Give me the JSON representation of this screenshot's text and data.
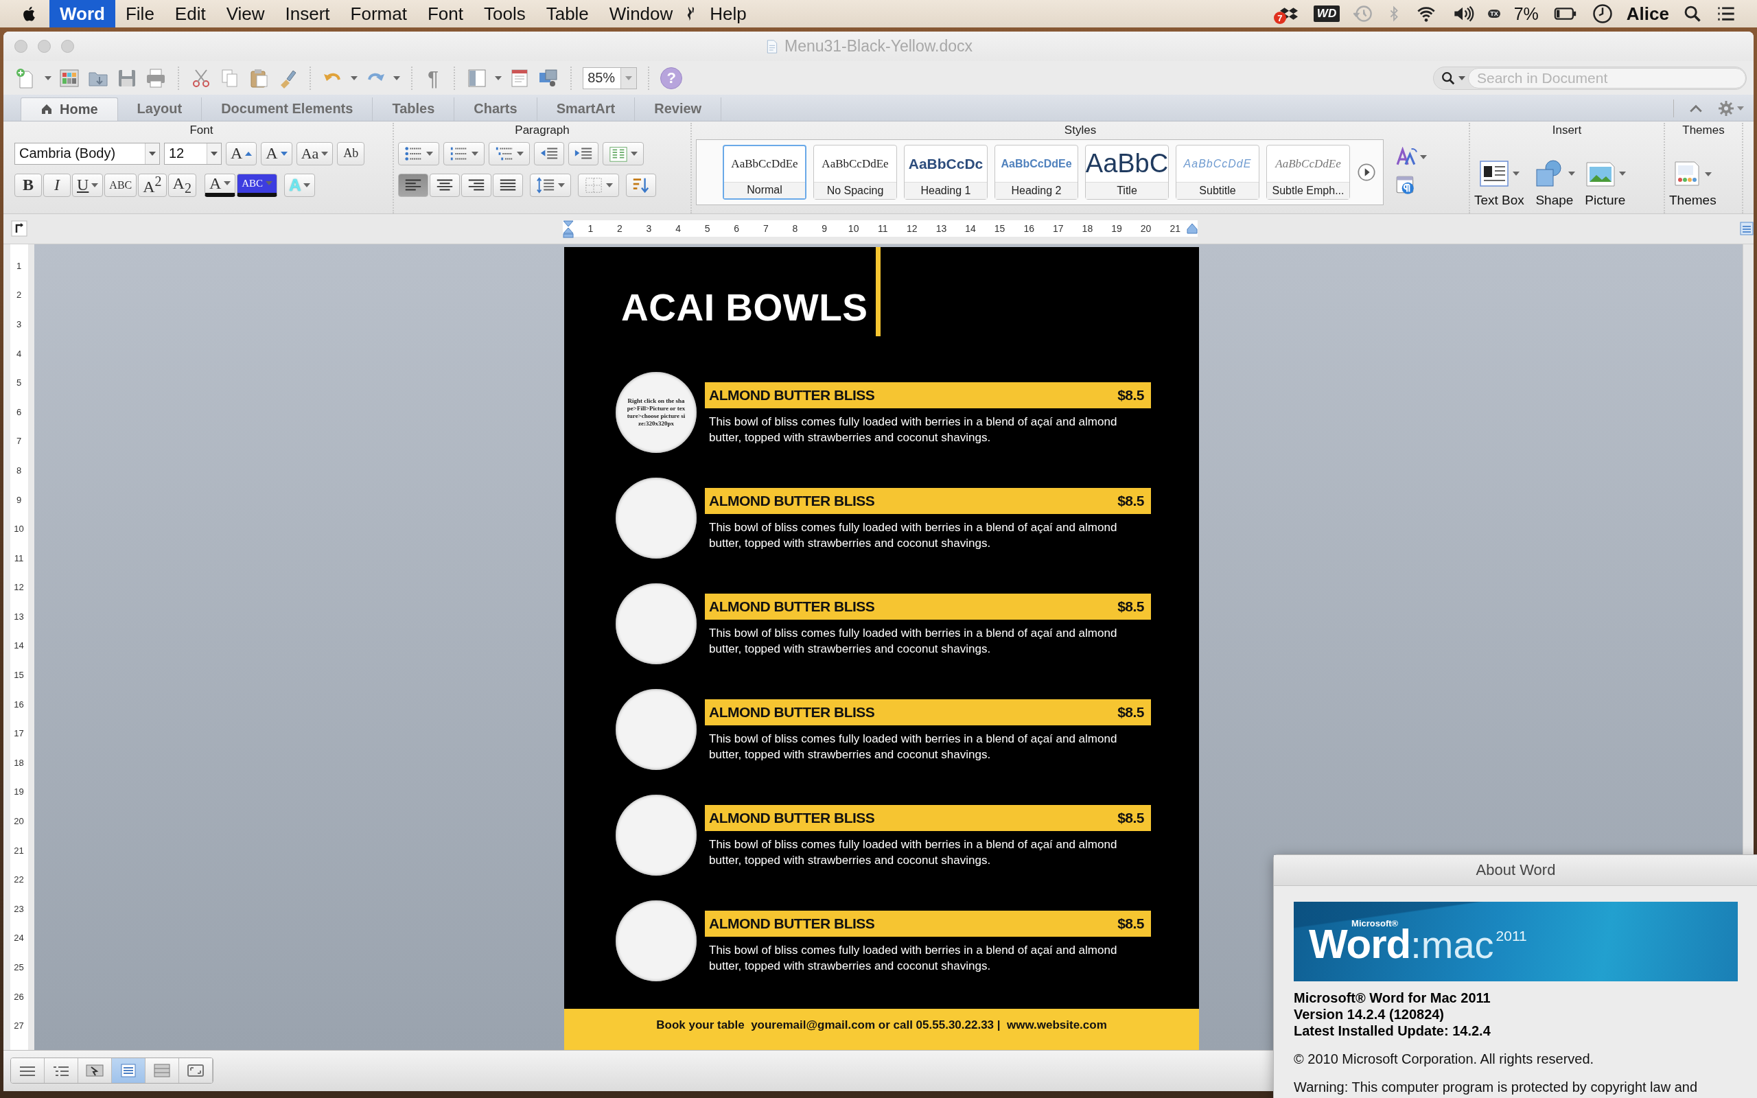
{
  "menu_bar": {
    "menus": [
      {
        "label": "Word",
        "selected": true
      },
      {
        "label": "File",
        "selected": false
      },
      {
        "label": "Edit",
        "selected": false
      },
      {
        "label": "View",
        "selected": false
      },
      {
        "label": "Insert",
        "selected": false
      },
      {
        "label": "Format",
        "selected": false
      },
      {
        "label": "Font",
        "selected": false
      },
      {
        "label": "Tools",
        "selected": false
      },
      {
        "label": "Table",
        "selected": false
      },
      {
        "label": "Window",
        "selected": false
      },
      {
        "label": "Help",
        "selected": false
      }
    ],
    "dropbox_badge": "7",
    "drive_label": "WD",
    "sync_label": "TX",
    "battery": "7%",
    "user": "Alice"
  },
  "window": {
    "title": "Menu31-Black-Yellow.docx"
  },
  "toolbar": {
    "paragraph_mark": "¶",
    "zoom": "85%",
    "help": "?",
    "search": {
      "placeholder": "Search in Document"
    }
  },
  "tabs": [
    {
      "label": "Home",
      "selected": true
    },
    {
      "label": "Layout",
      "selected": false
    },
    {
      "label": "Document Elements",
      "selected": false
    },
    {
      "label": "Tables",
      "selected": false
    },
    {
      "label": "Charts",
      "selected": false
    },
    {
      "label": "SmartArt",
      "selected": false
    },
    {
      "label": "Review",
      "selected": false
    }
  ],
  "ribbon": {
    "font": {
      "title": "Font",
      "name": "Cambria (Body)",
      "size": "12",
      "buttons": [
        {
          "label": "A",
          "kind": "grow"
        },
        {
          "label": "A",
          "kind": "shrink"
        },
        {
          "label": "Aa",
          "kind": "case"
        },
        {
          "label": "Ab",
          "kind": "clear"
        }
      ],
      "format_buttons": [
        {
          "label": "B",
          "kind": "bold"
        },
        {
          "label": "I",
          "kind": "italic"
        },
        {
          "label": "U",
          "kind": "underline"
        },
        {
          "label": "ABC",
          "kind": "strike"
        },
        {
          "label": "A$^{2}$",
          "kind": "plain"
        },
        {
          "label": "A$_{2}$",
          "kind": "plain"
        },
        {
          "label": "A",
          "kind": "color"
        },
        {
          "label": "ABC",
          "kind": "highlight"
        },
        {
          "label": "A",
          "kind": "effects"
        }
      ]
    },
    "paragraph": {
      "title": "Paragraph",
      "alignment_buttons": [
        {
          "selected": true
        },
        {
          "selected": false
        },
        {
          "selected": false
        },
        {
          "selected": false
        }
      ]
    },
    "styles": {
      "title": "Styles",
      "items": [
        {
          "preview": "AaBbCcDdEe",
          "label": "Normal",
          "kind": "normal",
          "selected": true
        },
        {
          "preview": "AaBbCcDdEe",
          "label": "No Spacing",
          "kind": "normal",
          "selected": false
        },
        {
          "preview": "AaBbCcDc",
          "label": "Heading 1",
          "kind": "heading1",
          "selected": false
        },
        {
          "preview": "AaBbCcDdEe",
          "label": "Heading 2",
          "kind": "heading2",
          "selected": false
        },
        {
          "preview": "AaBbC",
          "label": "Title",
          "kind": "title",
          "selected": false
        },
        {
          "preview": "AaBbCcDdE",
          "label": "Subtitle",
          "kind": "subtitle",
          "selected": false
        },
        {
          "preview": "AaBbCcDdEe",
          "label": "Subtle Emph...",
          "kind": "subtle",
          "selected": false
        }
      ]
    },
    "insert": {
      "title": "Insert",
      "items": [
        {
          "label": "Text Box",
          "kind": "textbox"
        },
        {
          "label": "Shape",
          "kind": "shape"
        },
        {
          "label": "Picture",
          "kind": "picture"
        }
      ]
    },
    "themes": {
      "title": "Themes",
      "label": "Themes"
    }
  },
  "rulers": {
    "horizontal": [
      "1",
      "2",
      "3",
      "4",
      "5",
      "6",
      "7",
      "8",
      "9",
      "10",
      "11",
      "12",
      "13",
      "14",
      "15",
      "16",
      "17",
      "18",
      "19",
      "20",
      "21"
    ],
    "vertical": [
      "1",
      "2",
      "3",
      "4",
      "5",
      "6",
      "7",
      "8",
      "9",
      "10",
      "11",
      "12",
      "13",
      "14",
      "15",
      "16",
      "17",
      "18",
      "19",
      "20",
      "21",
      "22",
      "23",
      "24",
      "25",
      "26",
      "27"
    ]
  },
  "document": {
    "heading": "ACAI BOWLS",
    "items": [
      {
        "title": "ALMOND BUTTER BLISS",
        "price": "$8.5",
        "description": "This bowl of bliss comes fully loaded with berries in a blend of açaí and almond butter, topped with strawberries and coconut shavings.",
        "circle_text": "Right click  on the shape>Fill>Picture or texture>choose picture size:320x320px"
      },
      {
        "title": "ALMOND BUTTER BLISS",
        "price": "$8.5",
        "description": "This bowl of bliss comes fully loaded with berries in a blend of açaí and almond butter, topped with strawberries and coconut shavings."
      },
      {
        "title": "ALMOND BUTTER BLISS",
        "price": "$8.5",
        "description": "This bowl of bliss comes fully loaded with berries in a blend of açaí and almond butter, topped with strawberries and coconut shavings."
      },
      {
        "title": "ALMOND BUTTER BLISS",
        "price": "$8.5",
        "description": "This bowl of bliss comes fully loaded with berries in a blend of açaí and almond butter, topped with strawberries and coconut shavings."
      },
      {
        "title": "ALMOND BUTTER BLISS",
        "price": "$8.5",
        "description": "This bowl of bliss comes fully loaded with berries in a blend of açaí and almond butter, topped with strawberries and coconut shavings."
      },
      {
        "title": "ALMOND BUTTER BLISS",
        "price": "$8.5",
        "description": "This bowl of bliss comes fully loaded with berries in a blend of açaí and almond butter, topped with strawberries and coconut shavings."
      }
    ],
    "footer": "Book your table  youremail@gmail.com or call 05.55.30.22.33 |  www.website.com"
  },
  "view_buttons": [
    {
      "selected": false
    },
    {
      "selected": false
    },
    {
      "selected": false
    },
    {
      "selected": true
    },
    {
      "selected": false
    },
    {
      "selected": false
    }
  ],
  "about": {
    "title": "About Word",
    "logo": {
      "brand": "Microsoft®",
      "name": "Word",
      "suffix": ":mac",
      "year": "2011"
    },
    "lines": [
      "Microsoft® Word for Mac 2011",
      "Version 14.2.4 (120824)",
      "Latest Installed Update: 14.2.4"
    ],
    "copyright": "© 2010 Microsoft Corporation. All rights reserved.",
    "warning": "Warning: This computer program is protected by copyright law and"
  }
}
